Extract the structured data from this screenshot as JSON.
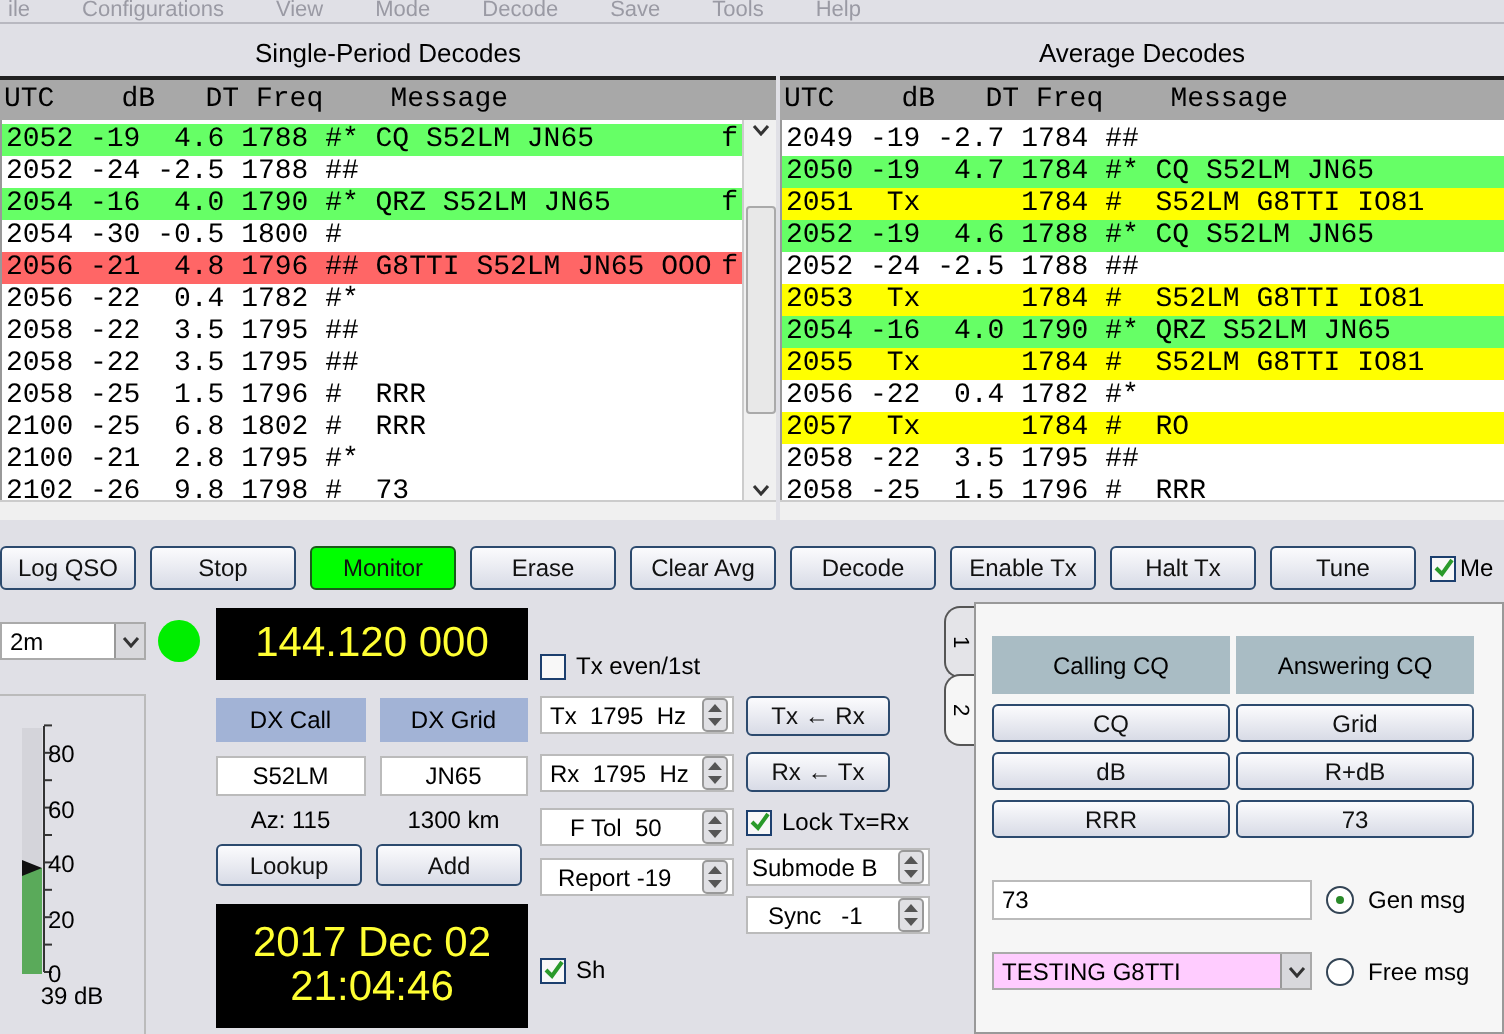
{
  "menu": [
    "ile",
    "Configurations",
    "View",
    "Mode",
    "Decode",
    "Save",
    "Tools",
    "Help"
  ],
  "single_period": {
    "title": "Single-Period Decodes",
    "columns": [
      "UTC",
      "dB",
      "DT",
      "Freq",
      "Message"
    ],
    "rows": [
      {
        "utc": "2052",
        "db": "-19",
        "dt": "4.6",
        "freq": "1788",
        "sync": "#*",
        "message": "CQ S52LM JN65",
        "flag": "f",
        "color": "#66ff66"
      },
      {
        "utc": "2052",
        "db": "-24",
        "dt": "-2.5",
        "freq": "1788",
        "sync": "##",
        "color": "#ffffff"
      },
      {
        "utc": "2054",
        "db": "-16",
        "dt": "4.0",
        "freq": "1790",
        "sync": "#*",
        "message": "QRZ S52LM JN65",
        "flag": "f",
        "color": "#66ff66"
      },
      {
        "utc": "2054",
        "db": "-30",
        "dt": "-0.5",
        "freq": "1800",
        "sync": "#",
        "color": "#ffffff"
      },
      {
        "utc": "2056",
        "db": "-21",
        "dt": "4.8",
        "freq": "1796",
        "sync": "##",
        "message": "G8TTI S52LM JN65 OOO",
        "flag": "f",
        "color": "#ff6666"
      },
      {
        "utc": "2056",
        "db": "-22",
        "dt": "0.4",
        "freq": "1782",
        "sync": "#*",
        "color": "#ffffff"
      },
      {
        "utc": "2058",
        "db": "-22",
        "dt": "3.5",
        "freq": "1795",
        "sync": "##",
        "color": "#ffffff"
      },
      {
        "utc": "2058",
        "db": "-22",
        "dt": "3.5",
        "freq": "1795",
        "sync": "##",
        "color": "#ffffff"
      },
      {
        "utc": "2058",
        "db": "-25",
        "dt": "1.5",
        "freq": "1796",
        "sync": "#",
        "message": "RRR",
        "color": "#ffffff"
      },
      {
        "utc": "2100",
        "db": "-25",
        "dt": "6.8",
        "freq": "1802",
        "sync": "#",
        "message": "RRR",
        "color": "#ffffff"
      },
      {
        "utc": "2100",
        "db": "-21",
        "dt": "2.8",
        "freq": "1795",
        "sync": "#*",
        "color": "#ffffff"
      },
      {
        "utc": "2102",
        "db": "-26",
        "dt": "9.8",
        "freq": "1798",
        "sync": "#",
        "message": "73",
        "color": "#ffffff"
      }
    ]
  },
  "average": {
    "title": "Average Decodes",
    "columns": [
      "UTC",
      "dB",
      "DT",
      "Freq",
      "Message"
    ],
    "rows": [
      {
        "utc": "2049",
        "db": "-19",
        "dt": "-2.7",
        "freq": "1784",
        "sync": "##",
        "color": "#ffffff"
      },
      {
        "utc": "2050",
        "db": "-19",
        "dt": "4.7",
        "freq": "1784",
        "sync": "#*",
        "message": "CQ S52LM JN65",
        "color": "#66ff66"
      },
      {
        "utc": "2051",
        "db": "Tx",
        "freq": "1784",
        "sync": "#",
        "message": "S52LM G8TTI IO81",
        "color": "#ffff00"
      },
      {
        "utc": "2052",
        "db": "-19",
        "dt": "4.6",
        "freq": "1788",
        "sync": "#*",
        "message": "CQ S52LM JN65",
        "color": "#66ff66"
      },
      {
        "utc": "2052",
        "db": "-24",
        "dt": "-2.5",
        "freq": "1788",
        "sync": "##",
        "color": "#ffffff"
      },
      {
        "utc": "2053",
        "db": "Tx",
        "freq": "1784",
        "sync": "#",
        "message": "S52LM G8TTI IO81",
        "color": "#ffff00"
      },
      {
        "utc": "2054",
        "db": "-16",
        "dt": "4.0",
        "freq": "1790",
        "sync": "#*",
        "message": "QRZ S52LM JN65",
        "color": "#66ff66"
      },
      {
        "utc": "2055",
        "db": "Tx",
        "freq": "1784",
        "sync": "#",
        "message": "S52LM G8TTI IO81",
        "color": "#ffff00"
      },
      {
        "utc": "2056",
        "db": "-22",
        "dt": "0.4",
        "freq": "1782",
        "sync": "#*",
        "color": "#ffffff"
      },
      {
        "utc": "2057",
        "db": "Tx",
        "freq": "1784",
        "sync": "#",
        "message": "RO",
        "color": "#ffff00"
      },
      {
        "utc": "2058",
        "db": "-22",
        "dt": "3.5",
        "freq": "1795",
        "sync": "##",
        "color": "#ffffff"
      },
      {
        "utc": "2058",
        "db": "-25",
        "dt": "1.5",
        "freq": "1796",
        "sync": "#",
        "message": "RRR",
        "color": "#ffffff"
      }
    ]
  },
  "buttons": [
    {
      "label": "Log QSO",
      "active": false
    },
    {
      "label": "Stop",
      "active": false
    },
    {
      "label": "Monitor",
      "active": true
    },
    {
      "label": "Erase",
      "active": false
    },
    {
      "label": "Clear Avg",
      "active": false
    },
    {
      "label": "Decode",
      "active": false
    },
    {
      "label": "Enable Tx",
      "active": false
    },
    {
      "label": "Halt Tx",
      "active": false
    },
    {
      "label": "Tune",
      "active": false
    }
  ],
  "menu_checkbox": {
    "label": "Me",
    "checked": true
  },
  "band": {
    "value": "2m"
  },
  "ready": true,
  "meter": {
    "level": 0.43,
    "reading": "39 dB",
    "ticks": [
      "80",
      "60",
      "40",
      "20",
      "0"
    ]
  },
  "frequency": "144.120 000",
  "dx": {
    "call_label": "DX Call",
    "grid_label": "DX Grid",
    "call": "S52LM",
    "grid": "JN65",
    "azimuth": "Az: 115",
    "distance": "1300 km",
    "lookup": "Lookup",
    "add": "Add"
  },
  "clock": {
    "date": "2017 Dec 02",
    "time": "21:04:46"
  },
  "tx_even": {
    "label": "Tx even/1st",
    "checked": false
  },
  "tx_freq": "Tx  1795  Hz",
  "rx_freq": "Rx  1795  Hz",
  "f_tol": "F Tol  50",
  "report": "Report -19",
  "sh": {
    "label": "Sh",
    "checked": true
  },
  "swap_buttons": [
    "Tx ← Rx",
    "Rx ← Tx"
  ],
  "lock": {
    "label": "Lock Tx=Rx",
    "checked": true
  },
  "submode": "Submode B",
  "sync": "Sync   -1",
  "tabs": [
    {
      "label": "1",
      "selected": false
    },
    {
      "label": "2",
      "selected": true
    }
  ],
  "messages": {
    "headers": [
      "Calling CQ",
      "Answering CQ"
    ],
    "buttons": [
      "CQ",
      "Grid",
      "dB",
      "R+dB",
      "RRR",
      "73"
    ],
    "gen": {
      "value": "73",
      "label": "Gen msg",
      "selected": true
    },
    "free": {
      "value": "TESTING G8TTI",
      "label": "Free msg",
      "selected": false
    }
  }
}
